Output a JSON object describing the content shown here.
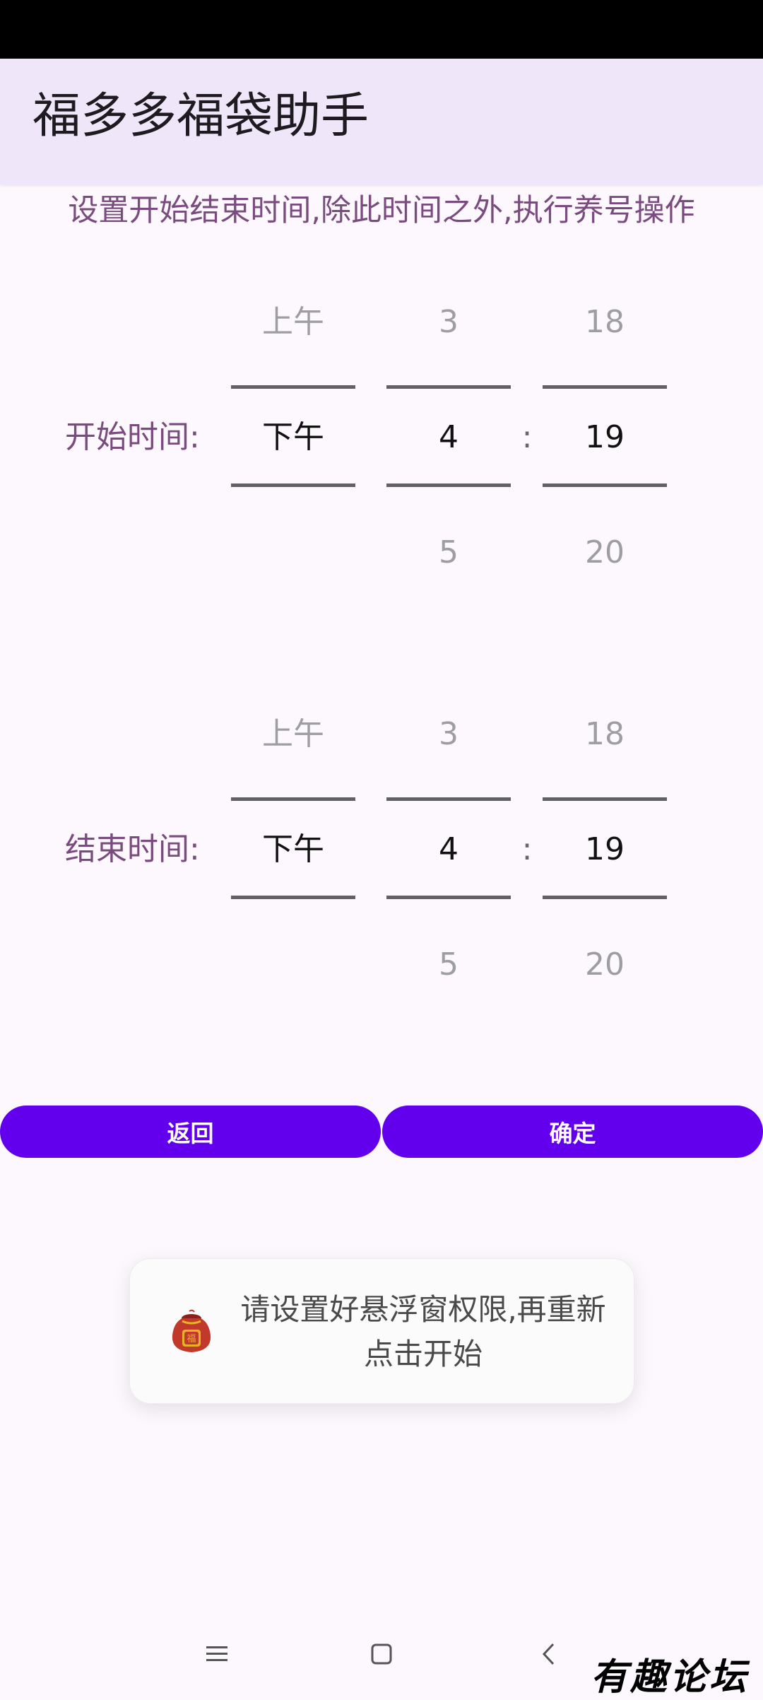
{
  "app": {
    "title": "福多多福袋助手"
  },
  "subtitle": "设置开始结束时间,除此时间之外,执行养号操作",
  "start_time": {
    "label": "开始时间:",
    "ampm": {
      "prev": "上午",
      "selected": "下午",
      "next": ""
    },
    "hour": {
      "prev": "3",
      "selected": "4",
      "next": "5"
    },
    "separator": ":",
    "minute": {
      "prev": "18",
      "selected": "19",
      "next": "20"
    }
  },
  "end_time": {
    "label": "结束时间:",
    "ampm": {
      "prev": "上午",
      "selected": "下午",
      "next": ""
    },
    "hour": {
      "prev": "3",
      "selected": "4",
      "next": "5"
    },
    "separator": ":",
    "minute": {
      "prev": "18",
      "selected": "19",
      "next": "20"
    }
  },
  "buttons": {
    "back_label": "返回",
    "confirm_label": "确定"
  },
  "toast": {
    "icon": "lucky-bag-icon",
    "message": "请设置好悬浮窗权限,再重新点击开始"
  },
  "nav": {
    "menu_icon": "menu-icon",
    "home_icon": "home-icon",
    "back_icon": "back-icon"
  },
  "watermark": "有趣论坛",
  "colors": {
    "app_bar": "#f0e6fa",
    "accent": "#6200ee",
    "label": "#7a4b7f",
    "background": "#fdf8fd"
  }
}
